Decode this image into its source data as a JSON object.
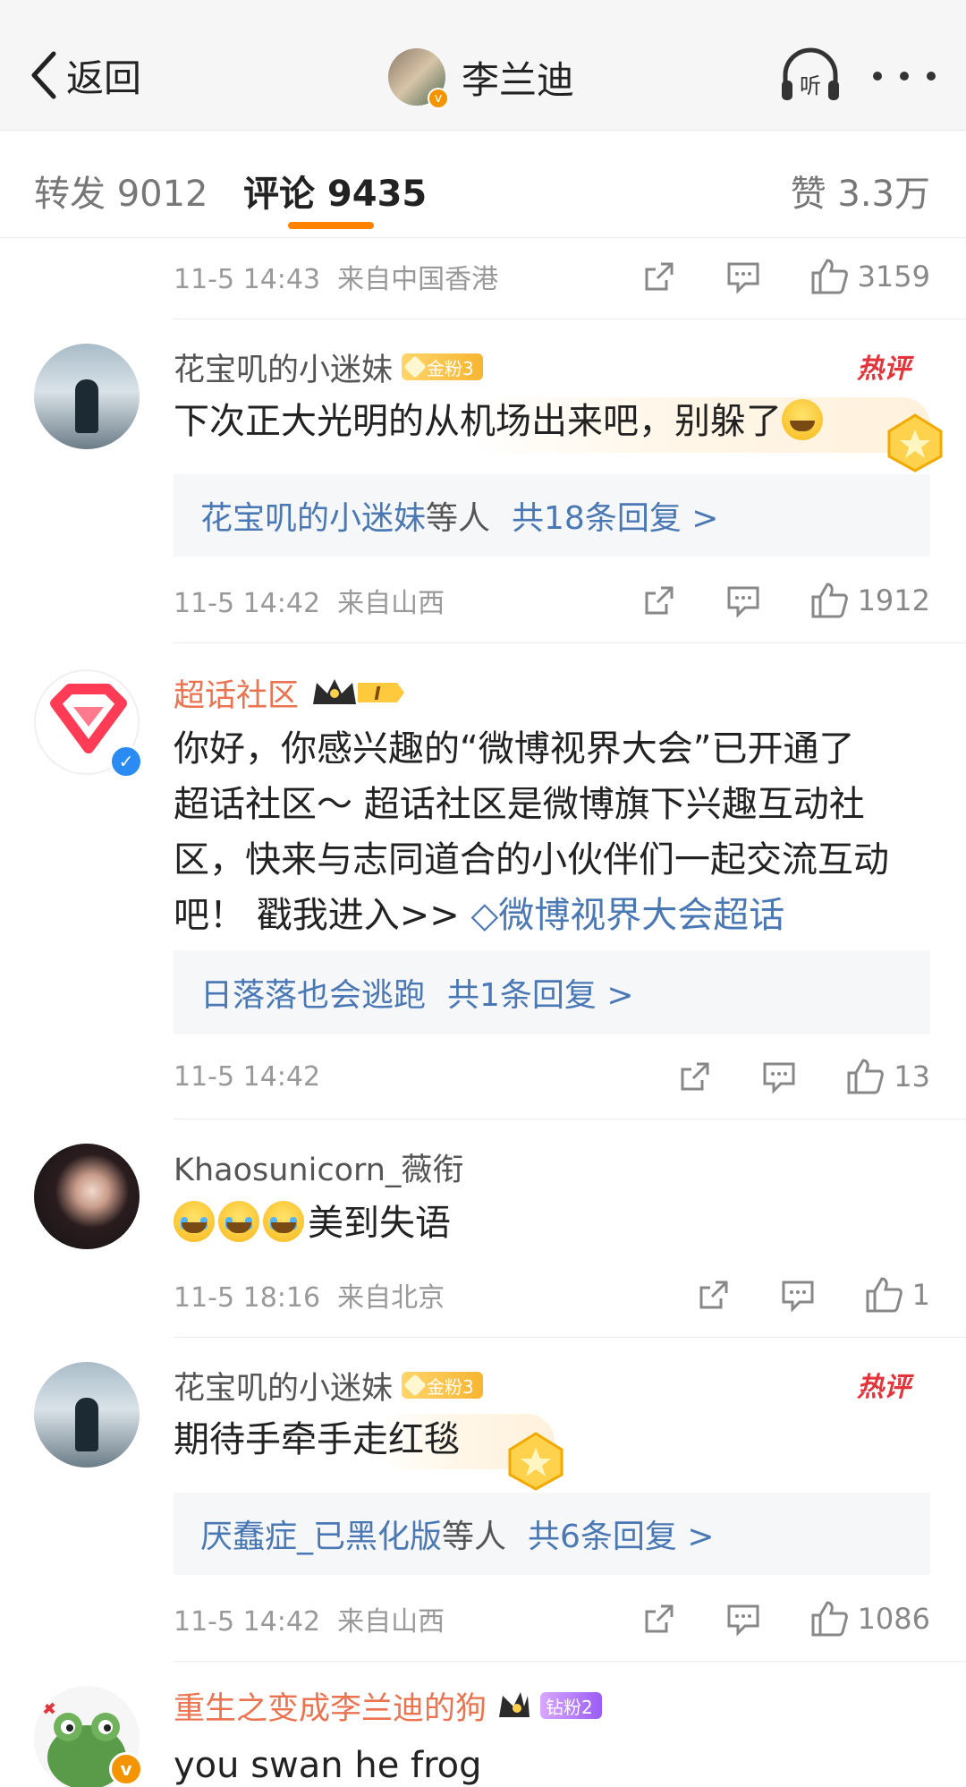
{
  "header": {
    "back_label": "返回",
    "title": "李兰迪",
    "listen_label": "听"
  },
  "tabs": {
    "repost": "转发 9012",
    "comments": "评论 9435",
    "likes": "赞 3.3万"
  },
  "top_meta": {
    "time": "11-5 14:43",
    "location": "来自中国香港",
    "likes": "3159"
  },
  "comments": [
    {
      "user": "花宝叽的小迷妹",
      "badge": "金粉3",
      "hot_label": "热评",
      "text": "下次正大光明的从机场出来吧，别躲了",
      "reply_name": "花宝叽的小迷妹",
      "reply_suffix": "等人",
      "reply_count": "共18条回复 >",
      "time": "11-5 14:42",
      "location": "来自山西",
      "likes": "1912"
    },
    {
      "user": "超话社区",
      "crown_text": "I",
      "text_line1": "你好，你感兴趣的“微博视界大会”已开通了",
      "text_line2": "超话社区～ 超话社区是微博旗下兴趣互动社",
      "text_line3": "区，快来与志同道合的小伙伴们一起交流互动",
      "text_line4": "吧！ 戳我进入>> ",
      "link_text": "微博视界大会超话",
      "reply_name": "日落落也会逃跑",
      "reply_count": "共1条回复 >",
      "time": "11-5 14:42",
      "likes": "13"
    },
    {
      "user": "Khaosunicorn_薇衔",
      "text": "美到失语",
      "time": "11-5 18:16",
      "location": "来自北京",
      "likes": "1"
    },
    {
      "user": "花宝叽的小迷妹",
      "badge": "金粉3",
      "hot_label": "热评",
      "text": "期待手牵手走红毯",
      "reply_name": "厌蠢症_已黑化版",
      "reply_suffix": "等人",
      "reply_count": "共6条回复 >",
      "time": "11-5 14:42",
      "location": "来自山西",
      "likes": "1086"
    },
    {
      "user": "重生之变成李兰迪的狗",
      "badge": "钻粉2",
      "text": "you swan he frog"
    }
  ],
  "colors": {
    "accent": "#ff8200",
    "link": "#4a78b5",
    "orange_name": "#eb7350",
    "hot": "#e3343c"
  }
}
